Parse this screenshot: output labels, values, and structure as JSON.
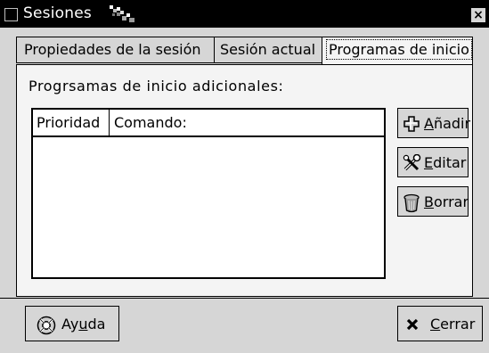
{
  "window": {
    "title": "Sesiones",
    "close_icon": "close-icon",
    "close_glyph": "×"
  },
  "tabs": [
    {
      "label": "Propiedades de la sesión",
      "active": false
    },
    {
      "label": "Sesión actual",
      "active": false
    },
    {
      "label": "Programas de inicio",
      "active": true
    }
  ],
  "main": {
    "section_label": "Progrsamas de inicio adicionales:",
    "list": {
      "columns": [
        "Prioridad",
        "Comando:"
      ],
      "rows": []
    },
    "buttons": [
      {
        "label_mnemonic": "A",
        "label_rest": "ñadir",
        "icon": "add-icon"
      },
      {
        "label_mnemonic": "E",
        "label_rest": "ditar",
        "icon": "tools-icon"
      },
      {
        "label_mnemonic": "B",
        "label_rest": "orrar",
        "icon": "trash-icon"
      }
    ]
  },
  "footer": {
    "help": {
      "label_pre": "Ay",
      "label_mnemonic": "u",
      "label_post": "da",
      "icon": "help-lifebuoy-icon"
    },
    "close": {
      "label_mnemonic": "C",
      "label_rest": "errar",
      "icon": "close-x-icon"
    }
  }
}
